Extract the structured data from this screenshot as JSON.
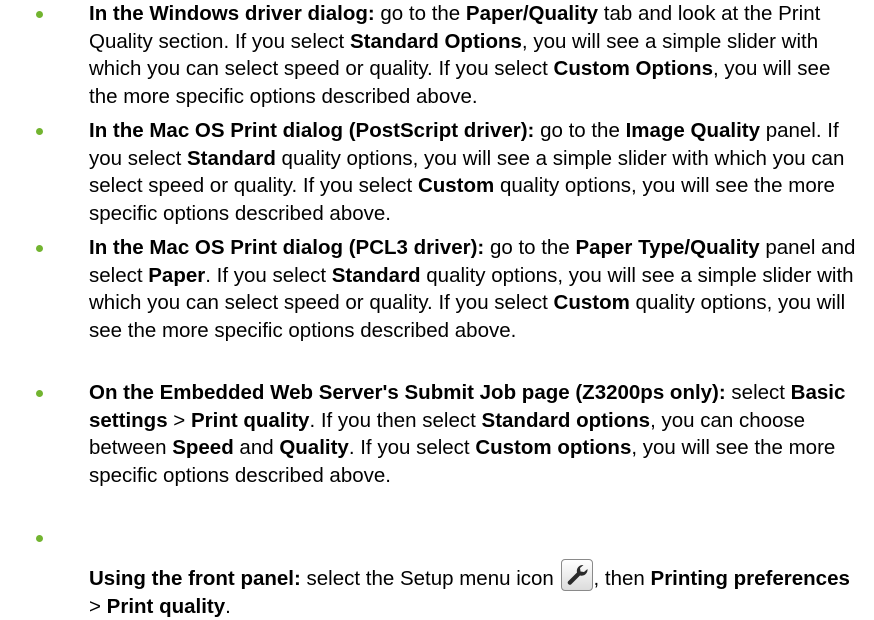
{
  "colors": {
    "bullet": "#72b430"
  },
  "items": [
    {
      "a": "In the Windows driver dialog:",
      "b": " go to the ",
      "c": "Paper/Quality",
      "d": " tab and look at the Print Quality section. If you select ",
      "e": "Standard Options",
      "f": ", you will see a simple slider with which you can select speed or quality. If you select ",
      "g": "Custom Options",
      "h": ", you will see the more specific options described above."
    },
    {
      "a": "In the Mac OS Print dialog (PostScript driver):",
      "b": " go to the ",
      "c": "Image Quality",
      "d": " panel. If you select ",
      "e": "Standard",
      "f": " quality options, you will see a simple slider with which you can select speed or quality. If you select ",
      "g": "Custom",
      "h": " quality options, you will see the more specific options described above."
    },
    {
      "a": "In the Mac OS Print dialog (PCL3 driver):",
      "b": " go to the ",
      "c": "Paper Type/Quality",
      "d": " panel and select ",
      "e": "Paper",
      "f": ". If you select ",
      "g": "Standard",
      "h": " quality options, you will see a simple slider with which you can select speed or quality. If you select ",
      "i": "Custom",
      "j": " quality options, you will see the more specific options described above."
    },
    {
      "a": "On the Embedded Web Server's Submit Job page (Z3200ps only):",
      "b": " select ",
      "c": "Basic settings",
      "d": " > ",
      "e": "Print quality",
      "f": ". If you then select ",
      "g": "Standard options",
      "h": ", you can choose between ",
      "i": "Speed",
      "j": " and ",
      "k": "Quality",
      "l": ". If you select ",
      "m": "Custom options",
      "n": ", you will see the more specific options described above."
    },
    {
      "a": "Using the front panel:",
      "b": " select the Setup menu icon ",
      "icon": "wrench-icon",
      "c": ", then ",
      "d": "Printing preferences",
      "e": " > ",
      "f": "Print quality",
      "g": "."
    }
  ]
}
